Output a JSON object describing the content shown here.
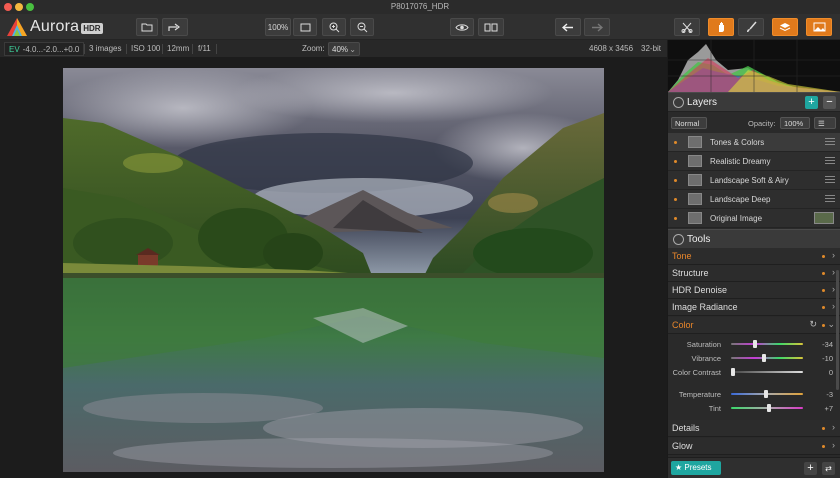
{
  "window": {
    "title": "P8017076_HDR"
  },
  "app": {
    "name": "Aurora",
    "badge": "HDR"
  },
  "toolbar": {
    "zoom_100_label": "100%",
    "icons": [
      "open-folder-icon",
      "share-icon",
      "fit-screen-icon",
      "zoom-in-icon",
      "zoom-out-icon",
      "eye-icon",
      "split-view-icon",
      "undo-icon",
      "redo-icon",
      "crop-icon",
      "hand-icon",
      "brush-icon",
      "layers-icon",
      "compare-icon"
    ]
  },
  "infobar": {
    "ev_label": "EV",
    "ev_values": "-4.0...-2.0...+0.0",
    "images": "3 images",
    "iso": "ISO 100",
    "focal": "12mm",
    "aperture": "f/11",
    "zoom_label": "Zoom:",
    "zoom_value": "40%",
    "dimensions": "4608 x 3456",
    "bit_depth": "32-bit"
  },
  "layers": {
    "title": "Layers",
    "blend_mode": "Normal",
    "opacity_label": "Opacity:",
    "opacity_value": "100%",
    "items": [
      {
        "name": "Tones & Colors"
      },
      {
        "name": "Realistic Dreamy"
      },
      {
        "name": "Landscape Soft & Airy"
      },
      {
        "name": "Landscape Deep"
      },
      {
        "name": "Original Image"
      }
    ]
  },
  "tools": {
    "title": "Tools",
    "items": [
      {
        "name": "Tone"
      },
      {
        "name": "Structure"
      },
      {
        "name": "HDR Denoise"
      },
      {
        "name": "Image Radiance"
      },
      {
        "name": "Color"
      }
    ],
    "color_sliders": [
      {
        "label": "Saturation",
        "value": "-34",
        "fraction": 0.33
      },
      {
        "label": "Vibrance",
        "value": "-10",
        "fraction": 0.45
      },
      {
        "label": "Color Contrast",
        "value": "0",
        "fraction": 0.0
      },
      {
        "label": "Temperature",
        "value": "-3",
        "fraction": 0.48
      },
      {
        "label": "Tint",
        "value": "+7",
        "fraction": 0.53
      }
    ],
    "bottom_items": [
      {
        "name": "Details"
      },
      {
        "name": "Glow"
      }
    ]
  },
  "footer": {
    "presets_label": "★ Presets"
  },
  "colors": {
    "accent_orange": "#e08a2a",
    "presets_teal": "#1fa6a0",
    "ev_green": "#3fd39d",
    "layers_add": "#1fa6a0"
  }
}
